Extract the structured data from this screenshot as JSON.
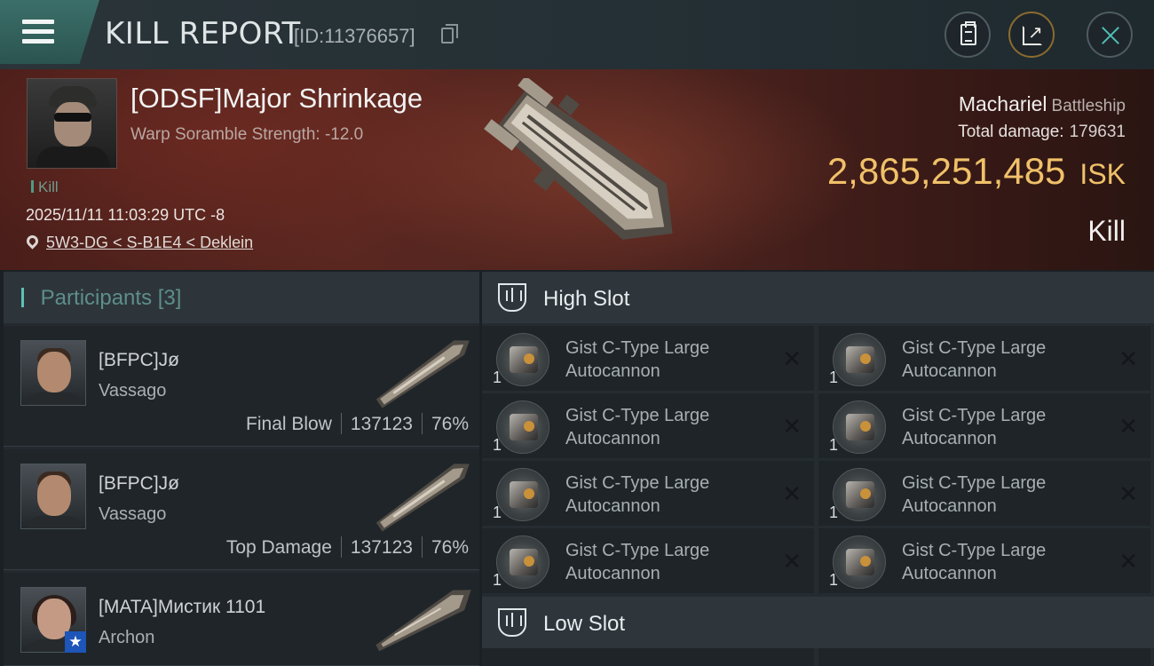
{
  "header": {
    "title": "KILL REPORT",
    "report_id": "[ID:11376657]"
  },
  "victim": {
    "pilot_name": "[ODSF]Major Shrinkage",
    "warp_scramble": "Warp Soramble Strength: -12.0",
    "kill_tag": "Kill",
    "datetime": "2025/11/11 11:03:29 UTC -8",
    "location": "5W3-DG < S-B1E4 < Deklein",
    "ship_name": "Machariel",
    "ship_class": "Battleship",
    "total_damage_label": "Total damage:",
    "total_damage_value": "179631",
    "isk_value": "2,865,251,485",
    "isk_unit": "ISK",
    "result": "Kill"
  },
  "participants": {
    "title": "Participants",
    "count": "[3]",
    "items": [
      {
        "name": "[BFPC]Jø",
        "ship": "Vassago",
        "role": "Final Blow",
        "damage": "137123",
        "percent": "76%"
      },
      {
        "name": "[BFPC]Jø",
        "ship": "Vassago",
        "role": "Top Damage",
        "damage": "137123",
        "percent": "76%"
      },
      {
        "name": "[MATA]Мистик 1101",
        "ship": "Archon",
        "role": "",
        "damage": "",
        "percent": ""
      }
    ]
  },
  "slots": {
    "high": {
      "title": "High Slot",
      "modules": [
        {
          "qty": "1",
          "line1": "Gist C-Type Large",
          "line2": "Autocannon"
        },
        {
          "qty": "1",
          "line1": "Gist C-Type Large",
          "line2": "Autocannon"
        },
        {
          "qty": "1",
          "line1": "Gist C-Type Large",
          "line2": "Autocannon"
        },
        {
          "qty": "1",
          "line1": "Gist C-Type Large",
          "line2": "Autocannon"
        },
        {
          "qty": "1",
          "line1": "Gist C-Type Large",
          "line2": "Autocannon"
        },
        {
          "qty": "1",
          "line1": "Gist C-Type Large",
          "line2": "Autocannon"
        },
        {
          "qty": "1",
          "line1": "Gist C-Type Large",
          "line2": "Autocannon"
        },
        {
          "qty": "1",
          "line1": "Gist C-Type Large",
          "line2": "Autocannon"
        }
      ]
    },
    "low": {
      "title": "Low Slot"
    }
  },
  "icons": {
    "menu": "menu-icon",
    "copy": "copy-icon",
    "clipboard": "clipboard-icon",
    "share": "share-icon",
    "close": "close-icon",
    "location": "location-pin-icon",
    "slot": "slot-icon",
    "destroyed": "destroyed-x-icon"
  },
  "colors": {
    "isk": "#f0c169",
    "accent": "#5fc0b5",
    "hero_bg": "#4a1e1a"
  }
}
